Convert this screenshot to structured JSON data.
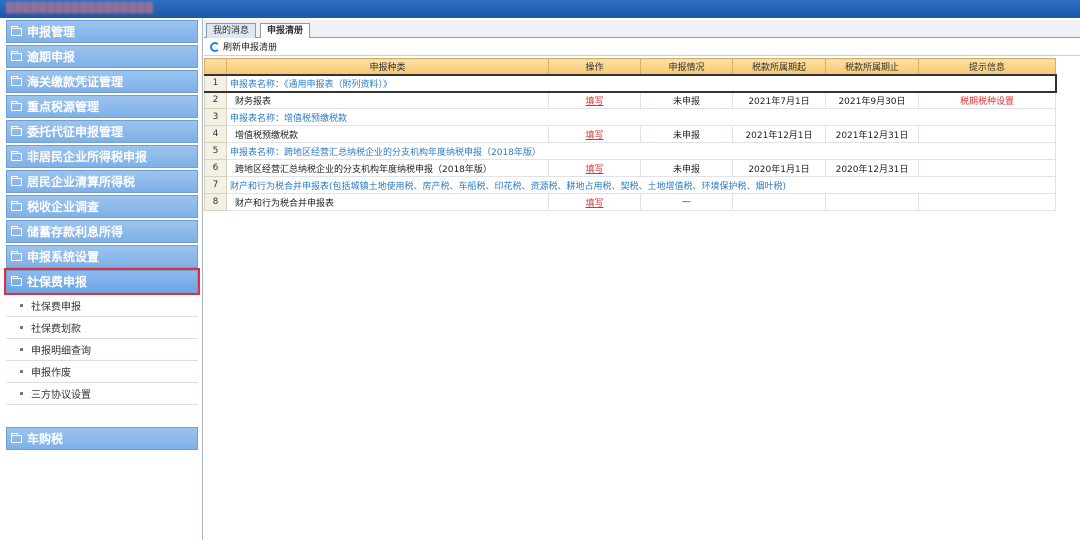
{
  "colors": {
    "accent": "#2c6fc4",
    "nav": "#86b6ea",
    "highlight": "#e0303a",
    "link_red": "#e03030",
    "section_blue": "#2a7bc8",
    "header": "#f5c66e"
  },
  "sidebar": {
    "groups_top": [
      {
        "label": "申报管理"
      },
      {
        "label": "逾期申报"
      },
      {
        "label": "海关缴款凭证管理"
      },
      {
        "label": "重点税源管理"
      },
      {
        "label": "委托代征申报管理"
      },
      {
        "label": "非居民企业所得税申报"
      },
      {
        "label": "居民企业清算所得税"
      },
      {
        "label": "税收企业调查"
      },
      {
        "label": "储蓄存款利息所得"
      },
      {
        "label": "申报系统设置"
      }
    ],
    "active_group": {
      "label": "社保费申报"
    },
    "subitems": [
      {
        "label": "社保费申报"
      },
      {
        "label": "社保费划款"
      },
      {
        "label": "申报明细查询"
      },
      {
        "label": "申报作废"
      },
      {
        "label": "三方协议设置"
      }
    ],
    "bottom_group": {
      "label": "车购税"
    }
  },
  "tabs": [
    {
      "label": "我的消息"
    },
    {
      "label": "申报清册"
    }
  ],
  "toolbar": {
    "refresh_label": "刷新申报清册"
  },
  "table": {
    "headers": [
      "申报种类",
      "操作",
      "申报情况",
      "税款所属期起",
      "税款所属期止",
      "提示信息"
    ],
    "rows": [
      {
        "num": "1",
        "section": "申报表名称：《通用申报表（附列资料）》"
      },
      {
        "num": "2",
        "type": "财务报表",
        "op": "填写",
        "status": "未申报",
        "start": "2021年7月1日",
        "end": "2021年9月30日",
        "hint": "税期税种设置"
      },
      {
        "num": "3",
        "section": "申报表名称：增值税预缴税款"
      },
      {
        "num": "4",
        "type": "增值税预缴税款",
        "op": "填写",
        "status": "未申报",
        "start": "2021年12月1日",
        "end": "2021年12月31日",
        "hint": ""
      },
      {
        "num": "5",
        "section": "申报表名称：跨地区经营汇总纳税企业的分支机构年度纳税申报（2018年版）"
      },
      {
        "num": "6",
        "type": "跨地区经营汇总纳税企业的分支机构年度纳税申报（2018年版）",
        "op": "填写",
        "status": "未申报",
        "start": "2020年1月1日",
        "end": "2020年12月31日",
        "hint": ""
      },
      {
        "num": "7",
        "section": "财产和行为税合并申报表(包括城镇土地使用税、房产税、车船税、印花税、资源税、耕地占用税、契税、土地增值税、环境保护税、烟叶税)"
      },
      {
        "num": "8",
        "type": "财产和行为税合并申报表",
        "op": "填写",
        "status": "—",
        "start": "",
        "end": "",
        "hint": ""
      }
    ]
  }
}
